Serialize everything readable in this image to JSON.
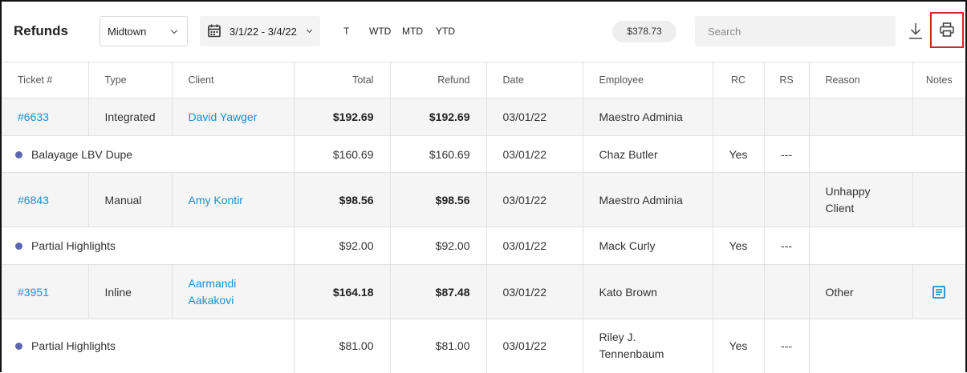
{
  "toolbar": {
    "title": "Refunds",
    "location": "Midtown",
    "date_range": "3/1/22 - 3/4/22",
    "range_buttons": [
      "T",
      "WTD",
      "MTD",
      "YTD"
    ],
    "total": "$378.73",
    "search_placeholder": "Search",
    "icons": {
      "calendar": "calendar-icon",
      "download": "download-icon",
      "print": "print-icon"
    }
  },
  "colors": {
    "link": "#1a8fd1",
    "dot": "#5c67b0",
    "highlight": "#d62525",
    "row_main": "#f5f5f5"
  },
  "table": {
    "headers": [
      "Ticket #",
      "Type",
      "Client",
      "Total",
      "Refund",
      "Date",
      "Employee",
      "RC",
      "RS",
      "Reason",
      "Notes"
    ],
    "rows": [
      {
        "kind": "main",
        "ticket": "#6633",
        "type": "Integrated",
        "client": "David Yawger",
        "total": "$192.69",
        "refund": "$192.69",
        "date": "03/01/22",
        "employee": "Maestro Adminia",
        "rc": "",
        "rs": "",
        "reason": "",
        "notes": ""
      },
      {
        "kind": "sub",
        "service": "Balayage LBV Dupe",
        "total": "$160.69",
        "refund": "$160.69",
        "date": "03/01/22",
        "employee": "Chaz Butler",
        "rc": "Yes",
        "rs": "---"
      },
      {
        "kind": "main",
        "ticket": "#6843",
        "type": "Manual",
        "client": "Amy Kontir",
        "total": "$98.56",
        "refund": "$98.56",
        "date": "03/01/22",
        "employee": "Maestro Adminia",
        "rc": "",
        "rs": "",
        "reason": "Unhappy Client",
        "notes": ""
      },
      {
        "kind": "sub",
        "service": "Partial Highlights",
        "total": "$92.00",
        "refund": "$92.00",
        "date": "03/01/22",
        "employee": "Mack Curly",
        "rc": "Yes",
        "rs": "---"
      },
      {
        "kind": "main",
        "ticket": "#3951",
        "type": "Inline",
        "client": "Aarmandi Aakakovi",
        "total": "$164.18",
        "refund": "$87.48",
        "date": "03/01/22",
        "employee": "Kato Brown",
        "rc": "",
        "rs": "",
        "reason": "Other",
        "notes": "note-icon"
      },
      {
        "kind": "sub",
        "service": "Partial Highlights",
        "total": "$81.00",
        "refund": "$81.00",
        "date": "03/01/22",
        "employee": "Riley J. Tennenbaum",
        "rc": "Yes",
        "rs": "---"
      }
    ]
  }
}
